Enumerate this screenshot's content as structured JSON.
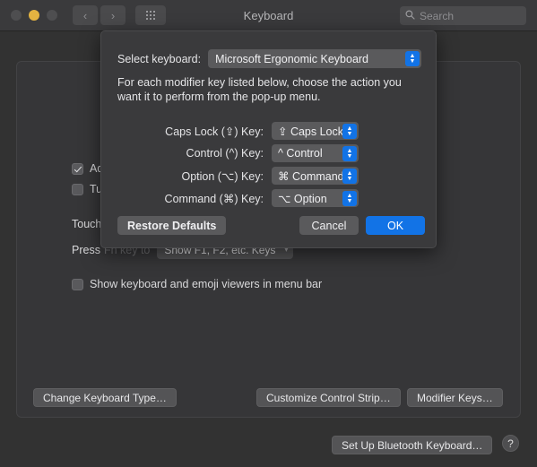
{
  "window": {
    "title": "Keyboard",
    "traffic_lights": [
      {
        "name": "close",
        "color": "#4e4e50"
      },
      {
        "name": "minimize",
        "color": "#e3b341"
      },
      {
        "name": "zoom",
        "color": "#4e4e50"
      }
    ],
    "nav": {
      "back": "‹",
      "forward": "›",
      "grid_icon": "grid-icon"
    },
    "search": {
      "placeholder": "Search",
      "value": "",
      "icon": "search-icon"
    }
  },
  "background": {
    "checkboxes": [
      {
        "label": "Adj",
        "checked": true
      },
      {
        "label": "Tur",
        "checked": false
      },
      {
        "label": "Show keyboard and emoji viewers in menu bar",
        "checked": false
      }
    ],
    "touch_label": "Touch",
    "press_label": "Press",
    "press_suffix": "Fn key to",
    "fn_popup_value": "Show F1, F2, etc. Keys",
    "buttons": {
      "change_keyboard_type": "Change Keyboard Type…",
      "customize_control_strip": "Customize Control Strip…",
      "modifier_keys": "Modifier Keys…",
      "set_up_bluetooth": "Set Up Bluetooth Keyboard…",
      "help": "?"
    }
  },
  "sheet": {
    "select_keyboard_label": "Select keyboard:",
    "selected_keyboard": "Microsoft Ergonomic Keyboard",
    "description": "For each modifier key listed below, choose the action you want it to perform from the pop-up menu.",
    "modifiers": [
      {
        "label": "Caps Lock (⇪) Key:",
        "value": "⇪ Caps Lock"
      },
      {
        "label": "Control (^) Key:",
        "value": "^ Control"
      },
      {
        "label": "Option (⌥) Key:",
        "value": "⌘ Command"
      },
      {
        "label": "Command (⌘) Key:",
        "value": "⌥ Option"
      }
    ],
    "restore_label": "Restore Defaults",
    "cancel_label": "Cancel",
    "ok_label": "OK",
    "accent_color": "#1273e6"
  }
}
